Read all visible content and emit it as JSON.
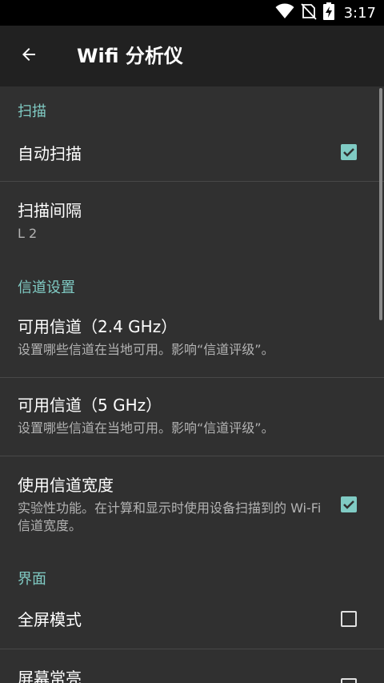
{
  "status_bar": {
    "time": "3:17"
  },
  "toolbar": {
    "title": "Wifi 分析仪"
  },
  "colors": {
    "accent": "#80cbc4",
    "background": "#303030",
    "toolbar": "#212121"
  },
  "sections": {
    "scan": {
      "header": "扫描",
      "auto_scan": {
        "title": "自动扫描",
        "checked": true
      },
      "scan_interval": {
        "title": "扫描间隔",
        "value": "L 2"
      }
    },
    "channel": {
      "header": "信道设置",
      "ch24": {
        "title": "可用信道（2.4 GHz）",
        "summary": "设置哪些信道在当地可用。影响“信道评级”。"
      },
      "ch5": {
        "title": "可用信道（5 GHz）",
        "summary": "设置哪些信道在当地可用。影响“信道评级”。"
      },
      "width": {
        "title": "使用信道宽度",
        "summary": "实验性功能。在计算和显示时使用设备扫描到的 Wi-Fi 信道宽度。",
        "checked": true
      }
    },
    "ui": {
      "header": "界面",
      "fullscreen": {
        "title": "全屏模式",
        "checked": false
      },
      "screen_on": {
        "title": "屏幕常亮",
        "checked": false
      }
    }
  }
}
